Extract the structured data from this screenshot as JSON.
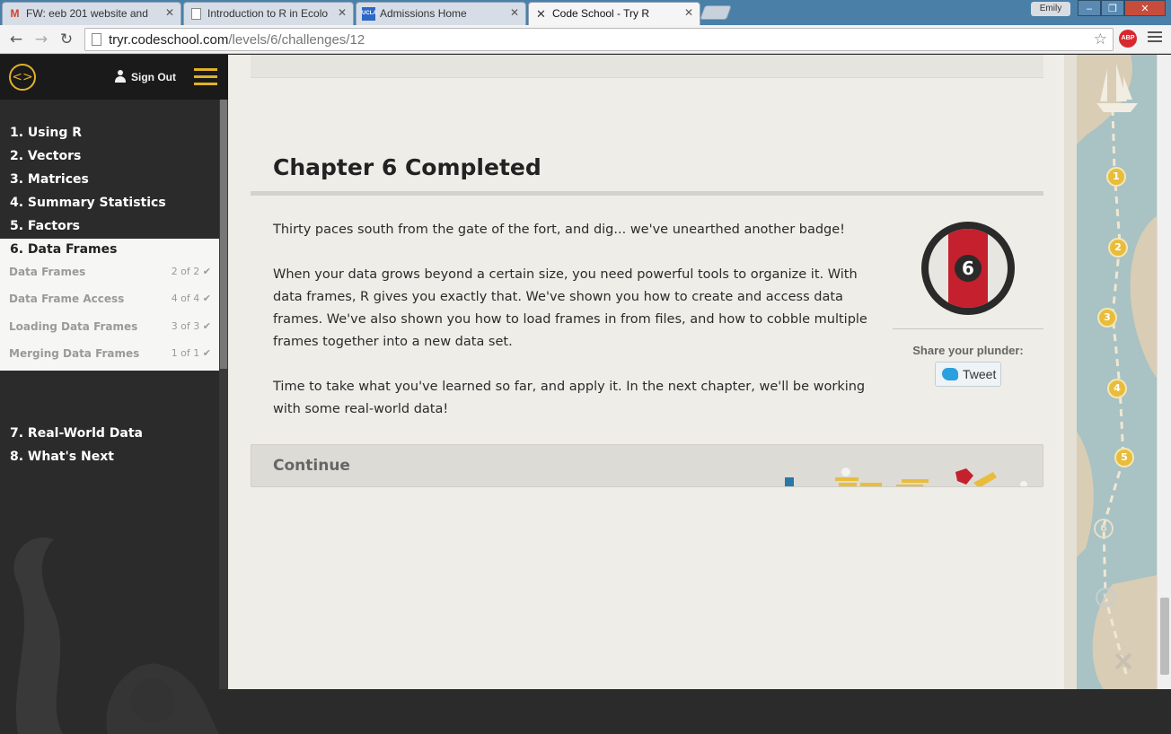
{
  "browser": {
    "tabs": [
      {
        "label": "FW: eeb 201 website and",
        "icon": "gmail-icon"
      },
      {
        "label": "Introduction to R in Ecolo",
        "icon": "page-icon"
      },
      {
        "label": "Admissions Home",
        "icon": "ucla-icon"
      },
      {
        "label": "Code School - Try R",
        "icon": "codeschool-icon"
      }
    ],
    "profile_name": "Emily",
    "url_host": "tryr.codeschool.com",
    "url_path": "/levels/6/challenges/12",
    "adblock_label": "ABP"
  },
  "sidebar": {
    "sign_out": "Sign Out",
    "chapters": [
      {
        "label": "1. Using R"
      },
      {
        "label": "2. Vectors"
      },
      {
        "label": "3. Matrices"
      },
      {
        "label": "4. Summary Statistics"
      },
      {
        "label": "5. Factors"
      },
      {
        "label": "6. Data Frames"
      },
      {
        "label": "7. Real-World Data"
      },
      {
        "label": "8. What's Next"
      }
    ],
    "challenges": [
      {
        "label": "Data Frames",
        "count": "2 of 2"
      },
      {
        "label": "Data Frame Access",
        "count": "4 of 4"
      },
      {
        "label": "Loading Data Frames",
        "count": "3 of 3"
      },
      {
        "label": "Merging Data Frames",
        "count": "1 of 1"
      }
    ]
  },
  "main": {
    "title": "Chapter 6 Completed",
    "paragraphs": [
      "Thirty paces south from the gate of the fort, and dig... we've unearthed another badge!",
      "When your data grows beyond a certain size, you need powerful tools to organize it. With data frames, R gives you exactly that. We've shown you how to create and access data frames. We've also shown you how to load frames in from files, and how to cobble multiple frames together into a new data set.",
      "Time to take what you've learned so far, and apply it. In the next chapter, we'll be working with some real-world data!"
    ],
    "badge_number": "6",
    "share_label": "Share your plunder:",
    "tweet_label": "Tweet",
    "continue_label": "Continue"
  },
  "map": {
    "nodes": [
      "1",
      "2",
      "3",
      "4",
      "5",
      "6",
      "7"
    ]
  },
  "colors": {
    "accent_gold": "#e0b12b",
    "badge_red": "#c4202e",
    "sidebar_bg": "#2b2b2b",
    "page_bg": "#efede7"
  }
}
